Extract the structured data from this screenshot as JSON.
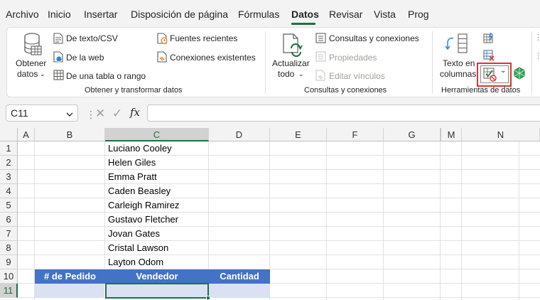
{
  "menu": {
    "tabs": [
      "Archivo",
      "Inicio",
      "Insertar",
      "Disposición de página",
      "Fórmulas",
      "Datos",
      "Revisar",
      "Vista",
      "Prog"
    ],
    "active": "Datos"
  },
  "ribbon": {
    "get_transform": {
      "obtener_line1": "Obtener",
      "obtener_line2": "datos",
      "from_text": "De texto/CSV",
      "from_web": "De la web",
      "from_table": "De una tabla o rango",
      "recent_sources": "Fuentes recientes",
      "existing_connections": "Conexiones existentes",
      "title": "Obtener y transformar datos"
    },
    "queries": {
      "refresh_line1": "Actualizar",
      "refresh_line2": "todo",
      "queries_connections": "Consultas y conexiones",
      "properties": "Propiedades",
      "edit_links": "Editar vínculos",
      "title": "Consultas y conexiones"
    },
    "data_tools": {
      "text_to_columns_line1": "Texto en",
      "text_to_columns_line2": "columnas",
      "title": "Herramientas de datos"
    }
  },
  "formula_bar": {
    "name_box": "C11",
    "fx": "fx",
    "cancel": "✕",
    "enter": "✓",
    "formula": ""
  },
  "sheet": {
    "columns": [
      "A",
      "B",
      "C",
      "D",
      "E",
      "F",
      "G",
      "M",
      "N"
    ],
    "rows": [
      "1",
      "2",
      "3",
      "4",
      "5",
      "6",
      "7",
      "8",
      "9",
      "10",
      "11"
    ],
    "names": [
      "Luciano Cooley",
      "Helen Giles",
      "Emma Pratt",
      "Caden Beasley",
      "Carleigh Ramirez",
      "Gustavo Fletcher",
      "Jovan Gates",
      "Cristal Lawson",
      "Layton Odom"
    ],
    "table_headers": [
      "# de Pedido",
      "Vendedor",
      "Cantidad"
    ],
    "active_cell": "C11"
  },
  "colors": {
    "accent": "#1e7145",
    "table_header": "#4472c4",
    "table_row": "#d9e1f2",
    "highlight_box": "#e03232"
  }
}
